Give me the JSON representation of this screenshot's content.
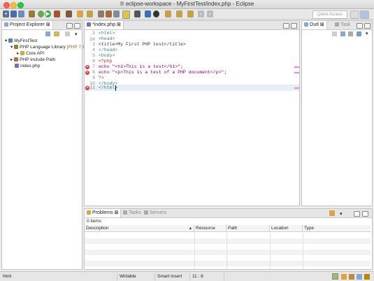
{
  "window": {
    "title": "eclipse-workspace - MyFirstTest/index.php - Eclipse"
  },
  "toolbar": {
    "quick_access_placeholder": "Quick Access"
  },
  "project_explorer": {
    "tab_label": "Project Explorer",
    "tree": {
      "project": "MyFirstTest",
      "library": "PHP Language Library",
      "library_suffix": "[PHP 7.1",
      "core_api": "Core API",
      "include_path": "PHP Include Path",
      "file": "index.php"
    }
  },
  "editor": {
    "tab_label": "*index.php",
    "lines": [
      {
        "num": "1",
        "text": "<html>"
      },
      {
        "num": "2⊖",
        "text": "<head>"
      },
      {
        "num": "3",
        "text": "<title>My First PHP test</title>"
      },
      {
        "num": "4",
        "text": "</head>"
      },
      {
        "num": "5",
        "text": "<body>"
      },
      {
        "num": "6",
        "text": "<?php"
      },
      {
        "num": "7",
        "text": "echo \"<h1>This is a test</h1>\";"
      },
      {
        "num": "8",
        "text": "echo \"<p>This is a test of a PHP document</p>\";"
      },
      {
        "num": "9",
        "text": "?>"
      },
      {
        "num": "10",
        "text": "</body>"
      },
      {
        "num": "11",
        "text": "</html>"
      }
    ]
  },
  "outline": {
    "tab_label": "Outl",
    "task_tab_label": "Task"
  },
  "bottom_panel": {
    "tabs": {
      "problems": "Problems",
      "tasks": "Tasks",
      "servers": "Servers"
    },
    "count": "0 items",
    "columns": {
      "description": "Description",
      "resource": "Resource",
      "path": "Path",
      "location": "Location",
      "type": "Type"
    }
  },
  "status_bar": {
    "file_type": "html",
    "writable": "Writable",
    "insert_mode": "Smart Insert",
    "position": "11 : 8"
  },
  "colors": {
    "error": "#d33333",
    "keyword": "#7f0055",
    "tag": "#3f7f7f",
    "marker": "#e58bd0"
  }
}
